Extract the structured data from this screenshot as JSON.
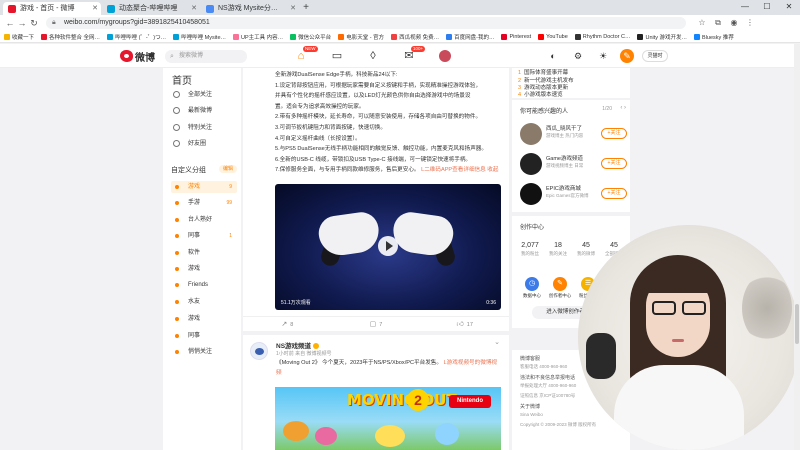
{
  "browser": {
    "tabs": [
      {
        "title": "游戏 - 首页 - 微博",
        "active": true,
        "color": "#e6162d"
      },
      {
        "title": "动态聚合-哔哩哔哩",
        "active": false,
        "color": "#00a1d6"
      },
      {
        "title": "NS游戏 Mysite分…",
        "active": false,
        "color": "#4a8af4"
      }
    ],
    "url": "weibo.com/mygroups?gid=3891825410458051",
    "bookmarks": [
      "收藏一下",
      "各种软件整合 全网…",
      "哔哩哔哩 (゜-゜)つ…",
      "哔哩哔哩 Mysite…",
      "UP主工具 内容…",
      "微信公众平台",
      "电影天堂 - 官方",
      "西瓜视频 免费…",
      "百度网盘-我的…",
      "Pinterest",
      "YouTube",
      "Rhythm Doctor C…",
      "Unity 游戏开发…",
      "Bluesky 推荐"
    ]
  },
  "weibo_header": {
    "logo_text": "微博",
    "search_placeholder": "搜索微博",
    "nav_badges": {
      "home": "NEW",
      "message": "100+"
    },
    "user_label": "灵猫时"
  },
  "sidebar": {
    "title": "首页",
    "items": [
      {
        "label": "全部关注",
        "icon": "≡"
      },
      {
        "label": "最新微博",
        "icon": "◷"
      },
      {
        "label": "特别关注",
        "icon": "☆"
      },
      {
        "label": "好友圈",
        "icon": "◎"
      }
    ],
    "group_title": "自定义分组",
    "manage_label": "编辑",
    "groups": [
      {
        "label": "游戏",
        "count": "9",
        "active": true
      },
      {
        "label": "手游",
        "count": "99",
        "active": false
      },
      {
        "label": "台人熟好",
        "count": "",
        "active": false
      },
      {
        "label": "同事",
        "count": "1",
        "active": false
      },
      {
        "label": "软件",
        "count": "",
        "active": false
      },
      {
        "label": "游戏",
        "count": "",
        "active": false
      },
      {
        "label": "Friends",
        "count": "",
        "active": false
      },
      {
        "label": "水友",
        "count": "",
        "active": false
      },
      {
        "label": "游戏",
        "count": "",
        "active": false
      },
      {
        "label": "同事",
        "count": "",
        "active": false
      },
      {
        "label": "悄悄关注",
        "count": "",
        "active": false
      }
    ]
  },
  "post1": {
    "lines": [
      "全新游戏DualSense Edge手柄，科技新品24以下:",
      "1.设定背部按钮应用，可根据玩家需要自定义按键和手柄，实现精准操控游戏体验，",
      "  并具有个性化的摇杆感应设置，以及LED灯光颜色供你自由选择游戏中的场景设",
      "  置。适合专为追求高效操控的玩家。",
      "2.带有多种摇杆模块，延长寿命，可以随意安装使用，存储各项自由可替换的物件。",
      "3.可调节扳机键阻力和背面按键，快速切换。",
      "4.可自定义摇杆曲线（长按设置）。",
      "5.与PS5 DualSense无线手柄功能相同的触觉反馈、触控功能，内置麦克风和扬声器。",
      "6.全新的USB-C 线缆，带锁扣及USB Type-C 接线端，可一键锁定快速将手柄。",
      "7.保修服务全面，与专用手柄同款维修服务，售后更安心。"
    ],
    "link_text": "L二维码APP查看详细信息 收起",
    "video_views": "51.1万次观看",
    "video_duration": "0:36",
    "actions": {
      "repost": "8",
      "comment": "7",
      "like": "17"
    }
  },
  "post2": {
    "author": "NS游戏频道",
    "meta": "1小时前 来自 微博视频号",
    "text": "《Moving Out 2》 今个夏天，2023年于NS/PS/Xbox/PC平台发售。",
    "link_text": "L游戏视频号的微博视频",
    "game_title": "MOVING OUT",
    "game_number": "2",
    "platform_badge": "Nintendo"
  },
  "right_col": {
    "hot": [
      {
        "n": "1",
        "text": "国际体育盛事开幕"
      },
      {
        "n": "2",
        "text": "新一代游戏主机发布"
      },
      {
        "n": "3",
        "text": "游戏动态版本更新"
      },
      {
        "n": "4",
        "text": "小游戏版本速览"
      }
    ],
    "rec_title": "你可能感兴趣的人",
    "rec_page": "1/20",
    "rec": [
      {
        "name": "西瓜_晓风干了",
        "desc": "游戏博主 热门内容",
        "follow": "+关注",
        "color": "#8a7a6a"
      },
      {
        "name": "Game游戏频道",
        "desc": "游戏视频博主 日常",
        "follow": "+关注",
        "color": "#222222"
      },
      {
        "name": "EPIC游戏商城",
        "desc": "Epic Games官方微博",
        "follow": "+关注",
        "color": "#111111"
      }
    ],
    "stats_title": "创作中心",
    "stats": [
      {
        "value": "2,077",
        "label": "我的粉丝"
      },
      {
        "value": "18",
        "label": "我的关注"
      },
      {
        "value": "45",
        "label": "我的微博"
      },
      {
        "value": "45",
        "label": "全部微博"
      }
    ],
    "tools": [
      {
        "label": "数据中心",
        "color": "#3d7be8",
        "icon": "◷"
      },
      {
        "label": "创作者中心",
        "color": "#ff8200",
        "icon": "✎"
      },
      {
        "label": "粉丝服务",
        "color": "#f5b300",
        "icon": "☰"
      }
    ],
    "enter_label": "进入微博创作者中心",
    "footer": [
      {
        "text": "微博客服",
        "h": true
      },
      {
        "text": "客服电话 4000-960-960",
        "h": false
      },
      {
        "text": "违法和不良信息举报电话",
        "h": true
      },
      {
        "text": "举报处理大厅 4000-960-960",
        "h": false
      },
      {
        "text": "证照信息 京ICP证100780号",
        "h": false
      },
      {
        "text": "关于微博",
        "h": true
      },
      {
        "text": "Sina Weibo",
        "h": false
      },
      {
        "text": "Copyright © 2009-2023 微博 版权所有",
        "h": false
      }
    ]
  }
}
